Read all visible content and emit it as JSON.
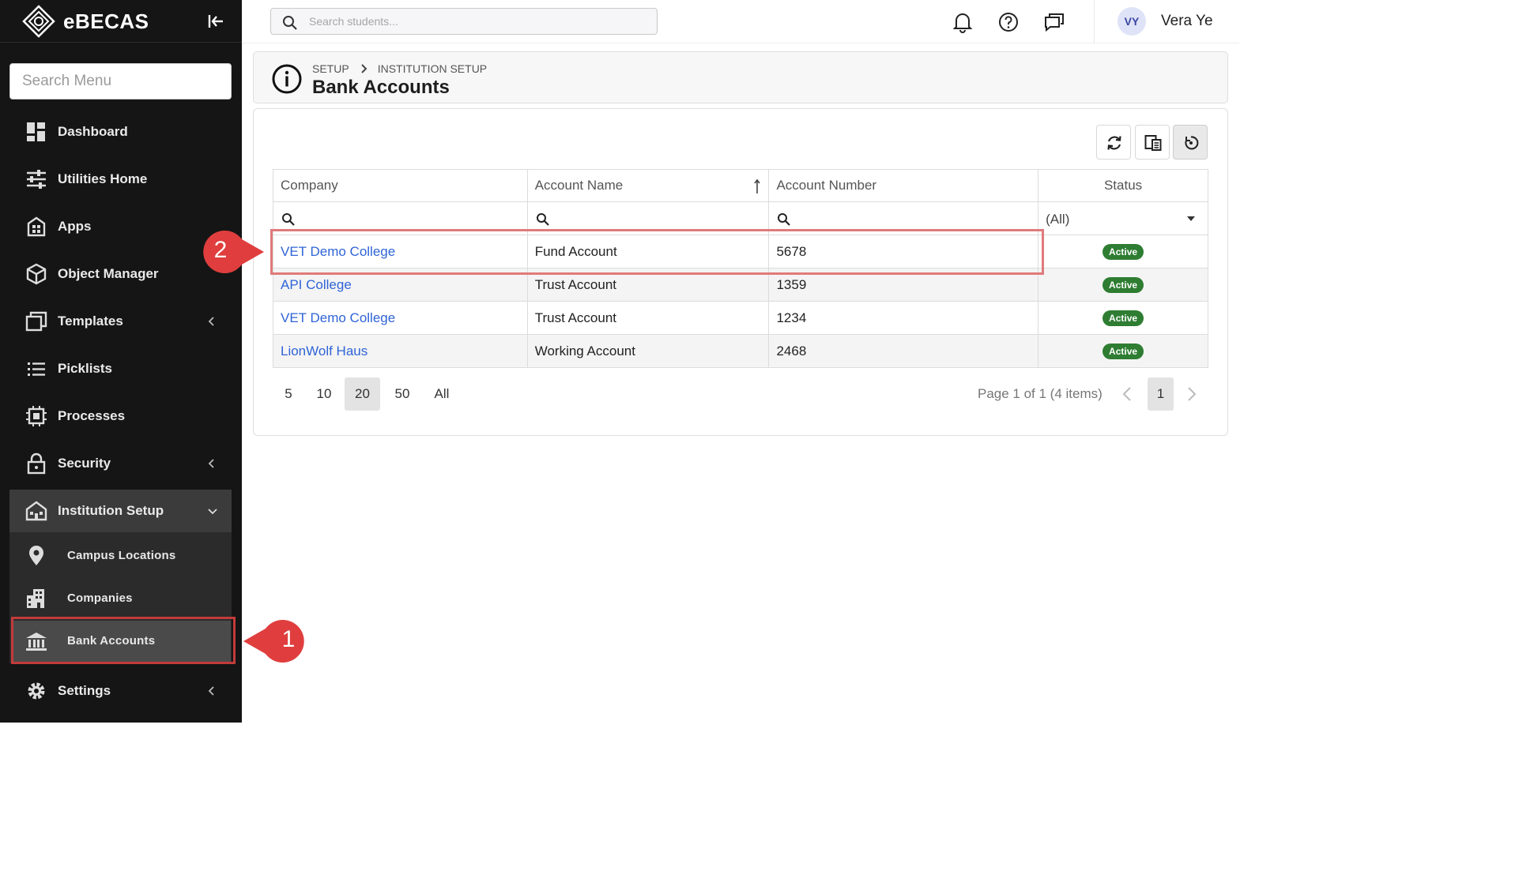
{
  "app": {
    "name": "eBECAS",
    "menu_search_placeholder": "Search Menu"
  },
  "sidebar": {
    "items": [
      {
        "label": "Dashboard",
        "icon": "dashboard-icon"
      },
      {
        "label": "Utilities Home",
        "icon": "sliders-icon"
      },
      {
        "label": "Apps",
        "icon": "apps-icon"
      },
      {
        "label": "Object Manager",
        "icon": "cube-icon"
      },
      {
        "label": "Templates",
        "icon": "templates-icon"
      },
      {
        "label": "Picklists",
        "icon": "list-icon"
      },
      {
        "label": "Processes",
        "icon": "chip-icon"
      },
      {
        "label": "Security",
        "icon": "lock-icon"
      },
      {
        "label": "Institution Setup",
        "icon": "institution-icon"
      },
      {
        "label": "Settings",
        "icon": "gear-icon"
      }
    ],
    "subitems": [
      {
        "label": "Campus Locations",
        "icon": "location-pin-icon"
      },
      {
        "label": "Companies",
        "icon": "building-icon"
      },
      {
        "label": "Bank Accounts",
        "icon": "bank-icon"
      }
    ]
  },
  "topbar": {
    "search_placeholder": "Search students...",
    "user_initials": "VY",
    "user_name": "Vera Ye"
  },
  "header": {
    "breadcrumb": [
      "SETUP",
      "INSTITUTION SETUP"
    ],
    "title": "Bank Accounts"
  },
  "grid": {
    "columns": [
      "Company",
      "Account Name",
      "Account Number",
      "Status"
    ],
    "status_filter": "(All)",
    "rows": [
      {
        "company": "VET Demo College",
        "account_name": "Fund Account",
        "account_number": "5678",
        "status": "Active"
      },
      {
        "company": "API College",
        "account_name": "Trust Account",
        "account_number": "1359",
        "status": "Active"
      },
      {
        "company": "VET Demo College",
        "account_name": "Trust Account",
        "account_number": "1234",
        "status": "Active"
      },
      {
        "company": "LionWolf Haus",
        "account_name": "Working Account",
        "account_number": "2468",
        "status": "Active"
      }
    ]
  },
  "pager": {
    "sizes": [
      "5",
      "10",
      "20",
      "50",
      "All"
    ],
    "selected_size": "20",
    "info": "Page 1 of 1 (4 items)",
    "current_page": "1"
  },
  "annotations": [
    "1",
    "2"
  ],
  "colors": {
    "sidebar_bg": "#151515",
    "link": "#2f64d6",
    "status_active": "#2e7d32",
    "annotation_red": "#e03e3e"
  }
}
